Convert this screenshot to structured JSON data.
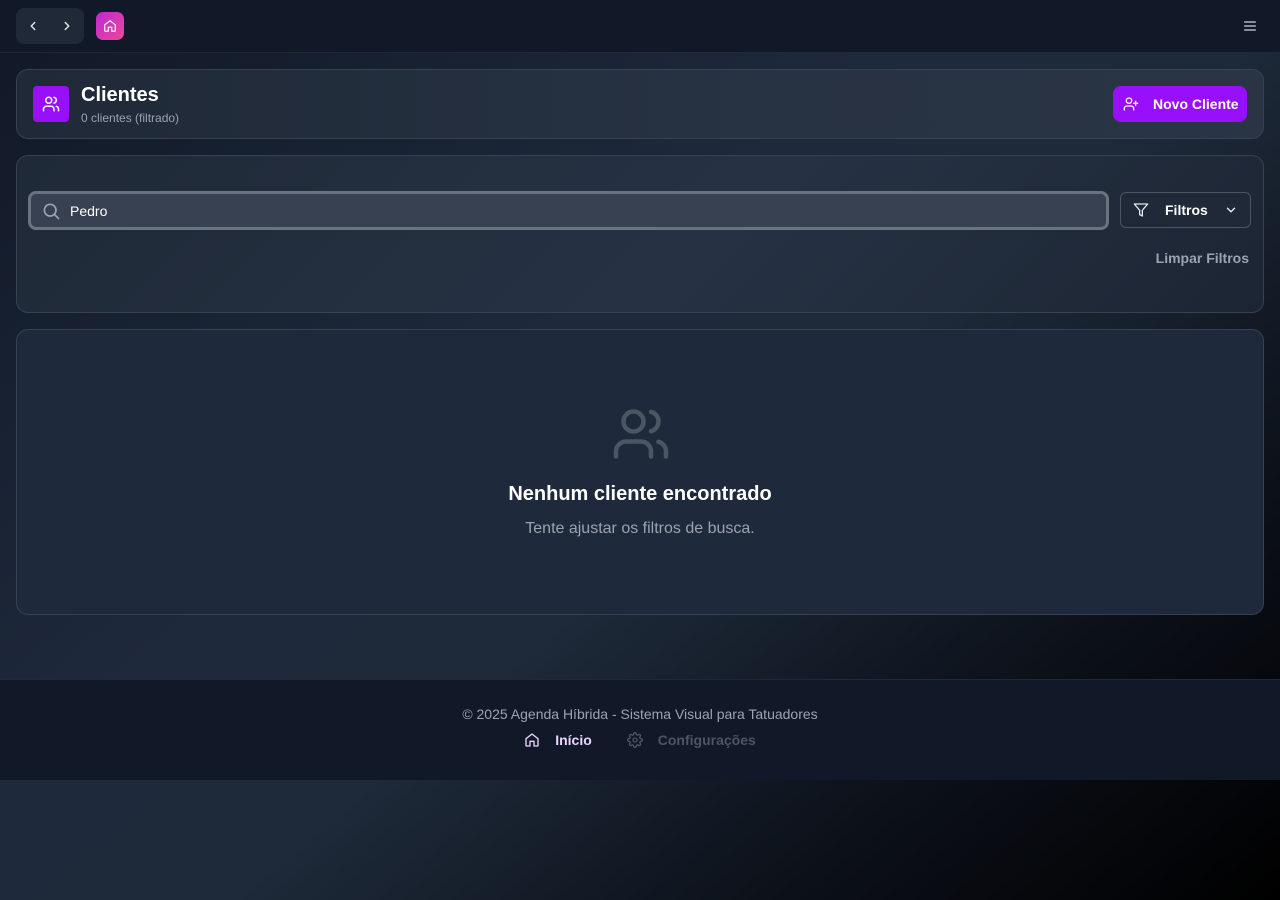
{
  "colors": {
    "accent": "#9810fa",
    "home_badge_start": "#c026d3",
    "home_badge_end": "#ec4899",
    "muted_text": "#9ca3af"
  },
  "topbar": {
    "back_icon": "chevron-left-icon",
    "forward_icon": "chevron-right-icon",
    "home_icon": "home-icon",
    "menu_icon": "hamburger-menu-icon"
  },
  "header": {
    "title": "Clientes",
    "subtitle": "0 clientes (filtrado)",
    "icon": "users-icon",
    "new_button_label": "Novo Cliente",
    "new_button_icon": "user-plus-icon"
  },
  "filters": {
    "search_value": "Pedro",
    "search_icon": "search-icon",
    "filters_label": "Filtros",
    "filters_icon": "funnel-icon",
    "clear_label": "Limpar Filtros"
  },
  "empty_state": {
    "icon": "users-icon",
    "title": "Nenhum cliente encontrado",
    "message": "Tente ajustar os filtros de busca."
  },
  "footer": {
    "copyright": "© 2025 Agenda Híbrida - Sistema Visual para Tatuadores",
    "links": [
      {
        "label": "Início",
        "icon": "home-icon",
        "state": "active"
      },
      {
        "label": "Configurações",
        "icon": "gear-icon",
        "state": "disabled"
      }
    ]
  }
}
